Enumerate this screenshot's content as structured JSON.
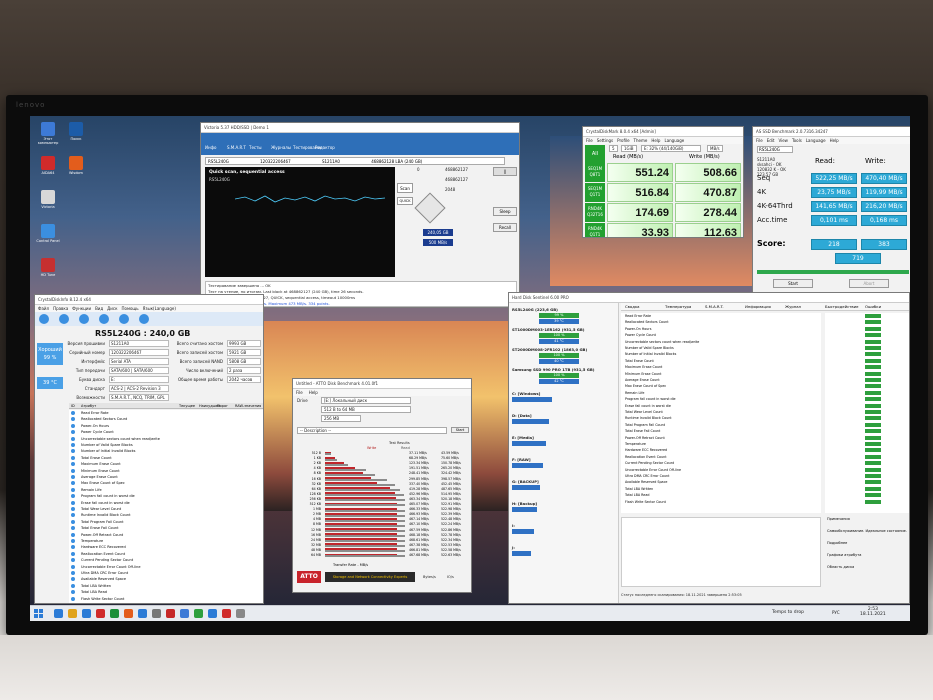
{
  "monitor": {
    "brand": "lenovo"
  },
  "hdd_sentinel_top": {
    "title": "Victoria 5.37 HDD/SSD | Demo 1",
    "tabs": [
      "Инфо",
      "S.M.A.R.T",
      "Тесты",
      "Журналы",
      "Тестирование",
      "Редактор"
    ],
    "model": "RS5L240G",
    "serial": "120322206467",
    "firmware": "S1211A0",
    "lba": "468862128 LBA (240 GB)",
    "status": "Quick scan, sequential access",
    "drive_label": "RS5L240G",
    "start_lba": "0",
    "end_lba": "468862127",
    "block": "2048",
    "size_gb": "240,05 GB",
    "speed": "500 MB/s",
    "time": "00:00",
    "scan_button": "Scan",
    "quick_button": "QUICK",
    "sleep_button": "Sleep",
    "recall_button": "Recall",
    "log_lines": [
      "Тестирование завершено ... OK",
      "Тест на чтение, по итогам. Last block at 468862127 (240 GB), time 26 seconds.",
      "Quick scan, LBA=0..468862127, QUICK, sequential access, timeout 10000ms",
      "...583 MB/s. Average 528 MB/s. Maximum 473 MB/s. 334 points."
    ]
  },
  "crystal_mark": {
    "title": "CrystalDiskMark 8.0.4 x64 [Admin]",
    "menu": [
      "File",
      "Settings",
      "Profile",
      "Theme",
      "Help",
      "Language"
    ],
    "all_label": "All",
    "runs": "5",
    "size": "1GiB",
    "drive": "E: 32% (44/140GiB)",
    "unit": "MB/s",
    "read_header": "Read (MB/s)",
    "write_header": "Write (MB/s)",
    "rows": [
      {
        "label": "SEQ1M Q8T1",
        "read": "551.24",
        "write": "508.66"
      },
      {
        "label": "SEQ1M Q1T1",
        "read": "516.84",
        "write": "470.87"
      },
      {
        "label": "RND4K Q32T16",
        "read": "174.69",
        "write": "278.44"
      },
      {
        "label": "RND4K Q1T1",
        "read": "33.93",
        "write": "112.63"
      }
    ]
  },
  "as_ssd": {
    "title": "AS SSD Benchmark 2.0.7316.34247",
    "menu": [
      "File",
      "Edit",
      "View",
      "Tools",
      "Language",
      "Help"
    ],
    "drive": "RS5L240G",
    "info_lines": [
      "S1211A0",
      "sksahci - OK",
      "120832 K - OK",
      "223.57 GB"
    ],
    "read_header": "Read:",
    "write_header": "Write:",
    "rows": [
      {
        "label": "Seq",
        "read": "522,25 MB/s",
        "write": "470,40 MB/s"
      },
      {
        "label": "4K",
        "read": "23,75 MB/s",
        "write": "119,99 MB/s"
      },
      {
        "label": "4K-64Thrd",
        "read": "141,65 MB/s",
        "write": "216,20 MB/s"
      },
      {
        "label": "Acc.time",
        "read": "0,101 ms",
        "write": "0,168 ms"
      }
    ],
    "score_label": "Score:",
    "score_read": "218",
    "score_write": "383",
    "score_total": "719",
    "start_button": "Start",
    "abort_button": "Abort"
  },
  "crystal_info": {
    "title": "CrystalDiskInfo 8.12.4 x64",
    "menu": [
      "Файл",
      "Правка",
      "Функции",
      "Вид",
      "Диск",
      "Помощь",
      "Язык(Language)"
    ],
    "headline": "RS5L240G : 240,0 GB",
    "health_label": "Хороший",
    "health_value": "99 %",
    "temp": "39 °C",
    "fields": [
      {
        "k": "Версия прошивки",
        "v": "S1211A0"
      },
      {
        "k": "Серийный номер",
        "v": "120322206467"
      },
      {
        "k": "Интерфейс",
        "v": "Serial ATA"
      },
      {
        "k": "Тип передачи",
        "v": "SATA/600 | SATA/600"
      },
      {
        "k": "Буква диска",
        "v": "E:"
      },
      {
        "k": "Стандарт",
        "v": "ACS-2 | ACS-2 Revision 3"
      },
      {
        "k": "Возможности",
        "v": "S.M.A.R.T., NCQ, TRIM, GPL"
      }
    ],
    "right_fields": [
      {
        "k": "Всего считано хостом",
        "v": "9993 GB"
      },
      {
        "k": "Всего записей хостом",
        "v": "5921 GB"
      },
      {
        "k": "Всего записей NAND",
        "v": "5808 GB"
      },
      {
        "k": "Число включений",
        "v": "2 раза"
      },
      {
        "k": "Общее время работы",
        "v": "2042 часов"
      }
    ],
    "table_headers": [
      "ID",
      "Атрибут",
      "Текущее",
      "Наихудшее",
      "Порог",
      "RAW-значения"
    ],
    "attributes": [
      "Read Error Rate",
      "Reallocated Sectors Count",
      "Power-On Hours",
      "Power Cycle Count",
      "Uncorrectable sectors count when read/write",
      "Number of Valid Spare Blocks",
      "Number of Initial Invalid Blocks",
      "Total Erase Count",
      "Maximum Erase Count",
      "Minimum Erase Count",
      "Average Erase Count",
      "Max Erase Count of Spec",
      "Remain Life",
      "Program fail count in worst die",
      "Erase fail count in worst die",
      "Total Wear Level Count",
      "Runtime Invalid Block Count",
      "Total Program Fail Count",
      "Total Erase Fail Count",
      "Power-Off Retract Count",
      "Temperature",
      "Hardware ECC Recovered",
      "Reallocation Event Count",
      "Current Pending Sector Count",
      "Uncorrectable Error Count Off-line",
      "Ultra DMA CRC Error Count",
      "Available Reserved Space",
      "Total LBA Written",
      "Total LBA Read",
      "Flash Write Sector Count"
    ]
  },
  "hd_sentinel": {
    "title": "Hard Disk Sentinel 6.00 PRO",
    "tabs": [
      "Сводка",
      "Температура",
      "S.M.A.R.T.",
      "Информация",
      "Журнал",
      "Быстродействие",
      "Ошибки"
    ],
    "disks": [
      {
        "name": "RS5L240G (223,6 GB)",
        "health": "99 %",
        "temp": "39 °C"
      },
      {
        "name": "ST1000DM003-1ER162 (931,5 GB)",
        "health": "100 %",
        "temp": "41 °C"
      },
      {
        "name": "ST2000DM008-2FR102 (1863,0 GB)",
        "health": "100 %",
        "temp": "40 °C"
      },
      {
        "name": "Samsung SSD 990 PRO 1TB (931,5 GB)",
        "health": "100 %",
        "temp": "42 °C"
      }
    ],
    "volumes": [
      "C: [Windows]",
      "D: [Data]",
      "E: [Media]",
      "F: [RAW]",
      "G: [BACKUP]",
      "H: [Backup]",
      "I:",
      "J:"
    ],
    "status_footer": "Статус последнего сканирования: 18.11.2021 завершено 2:53:05",
    "side_notes": [
      "Примечания",
      "Самообслуживание. Идеальное состояние.",
      "Подробнее",
      "Графики атрибута",
      "Область диска"
    ]
  },
  "atto": {
    "title": "Untitled - ATTO Disk Benchmark 4.01.0f1",
    "menu": [
      "File",
      "Help"
    ],
    "drive_label": "Drive",
    "drive": "[E:] Локальный диск",
    "io_size": "512 B  to  64 MB",
    "file_size": "256 MB",
    "description": "-- Description --",
    "start_button": "Start",
    "legend": [
      "Write",
      "Read"
    ],
    "results_label": "Test Results",
    "sizes": [
      "512 B",
      "1 KB",
      "2 KB",
      "4 KB",
      "8 KB",
      "16 KB",
      "32 KB",
      "64 KB",
      "128 KB",
      "256 KB",
      "512 KB",
      "1 MB",
      "2 MB",
      "4 MB",
      "8 MB",
      "12 MB",
      "16 MB",
      "24 MB",
      "32 MB",
      "48 MB",
      "64 MB"
    ],
    "write_col": [
      "37.11 MB/s",
      "68.29 MB/s",
      "123.34 MB/s",
      "191.51 MB/s",
      "248.41 MB/s",
      "299.85 MB/s",
      "337.40 MB/s",
      "419.28 MB/s",
      "452.96 MB/s",
      "463.34 MB/s",
      "465.07 MB/s",
      "466.33 MB/s",
      "466.93 MB/s",
      "467.14 MB/s",
      "467.10 MB/s",
      "467.59 MB/s",
      "468.18 MB/s",
      "468.61 MB/s",
      "467.38 MB/s",
      "466.81 MB/s",
      "467.68 MB/s"
    ],
    "read_col": [
      "43.59 MB/s",
      "75.60 MB/s",
      "150.78 MB/s",
      "265.20 MB/s",
      "324.42 MB/s",
      "398.57 MB/s",
      "452.45 MB/s",
      "487.65 MB/s",
      "514.95 MB/s",
      "520.18 MB/s",
      "522.91 MB/s",
      "522.98 MB/s",
      "522.39 MB/s",
      "522.48 MB/s",
      "522.24 MB/s",
      "522.86 MB/s",
      "522.78 MB/s",
      "522.34 MB/s",
      "522.53 MB/s",
      "522.58 MB/s",
      "522.63 MB/s"
    ],
    "write_frac": [
      0.07,
      0.13,
      0.24,
      0.37,
      0.48,
      0.58,
      0.65,
      0.81,
      0.87,
      0.89,
      0.9,
      0.9,
      0.9,
      0.9,
      0.9,
      0.9,
      0.9,
      0.9,
      0.9,
      0.9,
      0.9
    ],
    "read_frac": [
      0.08,
      0.15,
      0.29,
      0.51,
      0.62,
      0.77,
      0.87,
      0.94,
      0.99,
      1.0,
      1.0,
      1.0,
      1.0,
      1.0,
      1.0,
      1.0,
      1.0,
      1.0,
      1.0,
      1.0,
      1.0
    ],
    "x_axis": "Transfer Rate - MB/s",
    "unit_bytes": "Bytes/s",
    "unit_io": "IO/s",
    "brand": "ATTO",
    "tagline": "Storage and Network Connectivity Experts"
  },
  "desktop_icons": [
    {
      "label": "Этот компьютер",
      "color": "#3d7ad6"
    },
    {
      "label": "Поиск",
      "color": "#1c5ca8"
    },
    {
      "label": "AIDA64",
      "color": "#d02b2b"
    },
    {
      "label": "Wisdom",
      "color": "#e35d1c"
    },
    {
      "label": "Victoria",
      "color": "#d8d8d8"
    },
    {
      "label": "Control Panel",
      "color": "#3b8fe0"
    },
    {
      "label": "HD Tune",
      "color": "#c63030"
    }
  ],
  "taskbar": {
    "tray_text": "Temps to drop",
    "lang": "РУС",
    "time": "2:53",
    "date": "18.11.2021"
  }
}
